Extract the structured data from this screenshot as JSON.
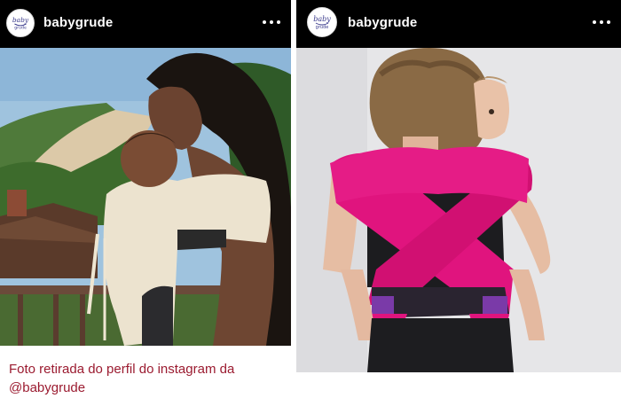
{
  "posts": [
    {
      "username": "babygrude",
      "avatar_text": "baby grude",
      "more_icon": "ellipsis-horizontal-icon"
    },
    {
      "username": "babygrude",
      "avatar_text": "baby grude",
      "more_icon": "ellipsis-horizontal-icon"
    }
  ],
  "caption": "Foto retirada do perfil do instagram da @babygrude",
  "colors": {
    "header_bg": "#000000",
    "caption_text": "#9b1b30",
    "wrap_pink": "#e0147e",
    "carrier_beige": "#ece3cf"
  }
}
